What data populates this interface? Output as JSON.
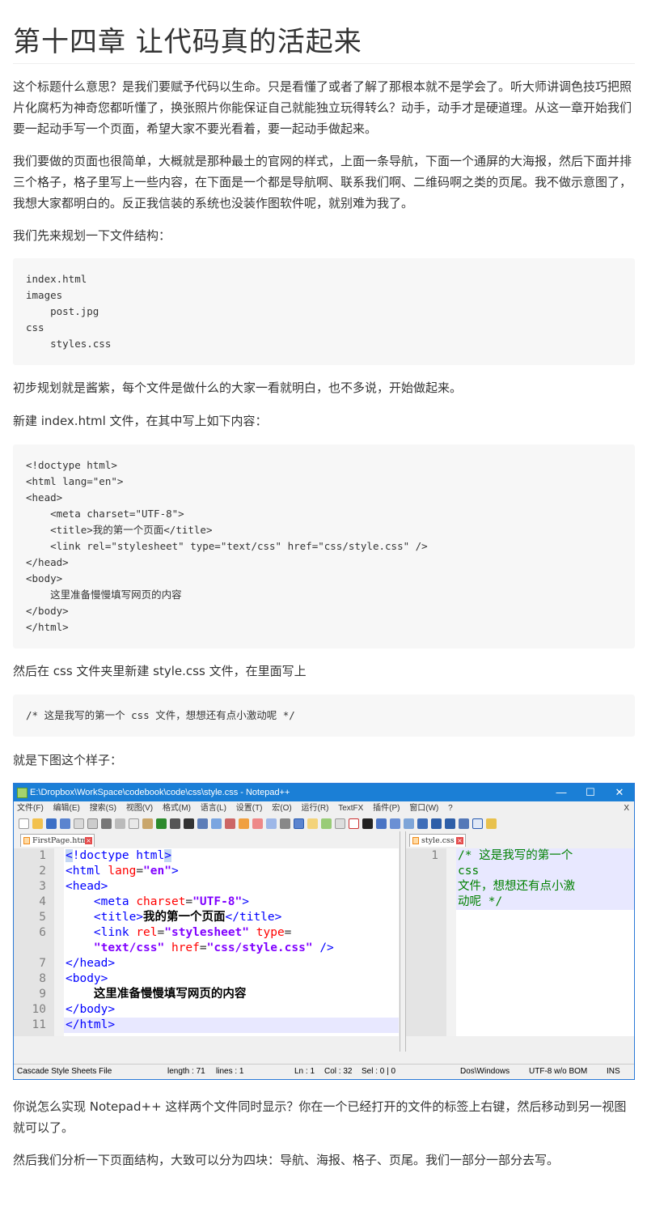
{
  "heading": "第十四章 让代码真的活起来",
  "paragraphs": [
    "这个标题什么意思？是我们要赋予代码以生命。只是看懂了或者了解了那根本就不是学会了。听大师讲调色技巧把照片化腐朽为神奇您都听懂了，换张照片你能保证自己就能独立玩得转么？动手，动手才是硬道理。从这一章开始我们要一起动手写一个页面，希望大家不要光看着，要一起动手做起来。",
    "我们要做的页面也很简单，大概就是那种最土的官网的样式，上面一条导航，下面一个通屏的大海报，然后下面并排三个格子，格子里写上一些内容，在下面是一个都是导航啊、联系我们啊、二维码啊之类的页尾。我不做示意图了，我想大家都明白的。反正我信装的系统也没装作图软件呢，就别难为我了。",
    "我们先来规划一下文件结构：",
    "初步规划就是酱紫，每个文件是做什么的大家一看就明白，也不多说，开始做起来。",
    "新建 index.html 文件，在其中写上如下内容：",
    "然后在 css 文件夹里新建 style.css 文件，在里面写上",
    "就是下图这个样子：",
    "你说怎么实现 Notepad++ 这样两个文件同时显示？你在一个已经打开的文件的标签上右键，然后移动到另一视图就可以了。",
    "然后我们分析一下页面结构，大致可以分为四块：导航、海报、格子、页尾。我们一部分一部分去写。"
  ],
  "code_blocks": [
    "index.html\nimages\n    post.jpg\ncss\n    styles.css",
    "<!doctype html>\n<html lang=\"en\">\n<head>\n    <meta charset=\"UTF-8\">\n    <title>我的第一个页面</title>\n    <link rel=\"stylesheet\" type=\"text/css\" href=\"css/style.css\" />\n</head>\n<body>\n    这里准备慢慢填写网页的内容\n</body>\n</html>",
    "/* 这是我写的第一个 css 文件，想想还有点小激动呢 */"
  ],
  "screenshot": {
    "window_title": "E:\\Dropbox\\WorkSpace\\codebook\\code\\css\\style.css - Notepad++",
    "window_buttons": [
      "—",
      "☐",
      "✕"
    ],
    "menu": [
      "文件(F)",
      "编辑(E)",
      "搜索(S)",
      "视图(V)",
      "格式(M)",
      "语言(L)",
      "设置(T)",
      "宏(O)",
      "运行(R)",
      "TextFX",
      "插件(P)",
      "窗口(W)",
      "?"
    ],
    "menu_close": "X",
    "tab_left": "FirstPage.html",
    "tab_right": "style.css",
    "left_line_numbers": [
      "1",
      "2",
      "3",
      "4",
      "5",
      "6",
      "",
      "7",
      "8",
      "9",
      "10",
      "11"
    ],
    "right_line_numbers": [
      "1"
    ],
    "css_lines": [
      "/* 这是我写的第一个",
      "css",
      "文件，想想还有点小激",
      "动呢 */"
    ],
    "status": {
      "file_type": "Cascade Style Sheets File",
      "length": "length : 71",
      "lines": "lines : 1",
      "ln": "Ln : 1",
      "col": "Col : 32",
      "sel": "Sel : 0 | 0",
      "eol": "Dos\\Windows",
      "encoding": "UTF-8 w/o BOM",
      "mode": "INS"
    }
  }
}
